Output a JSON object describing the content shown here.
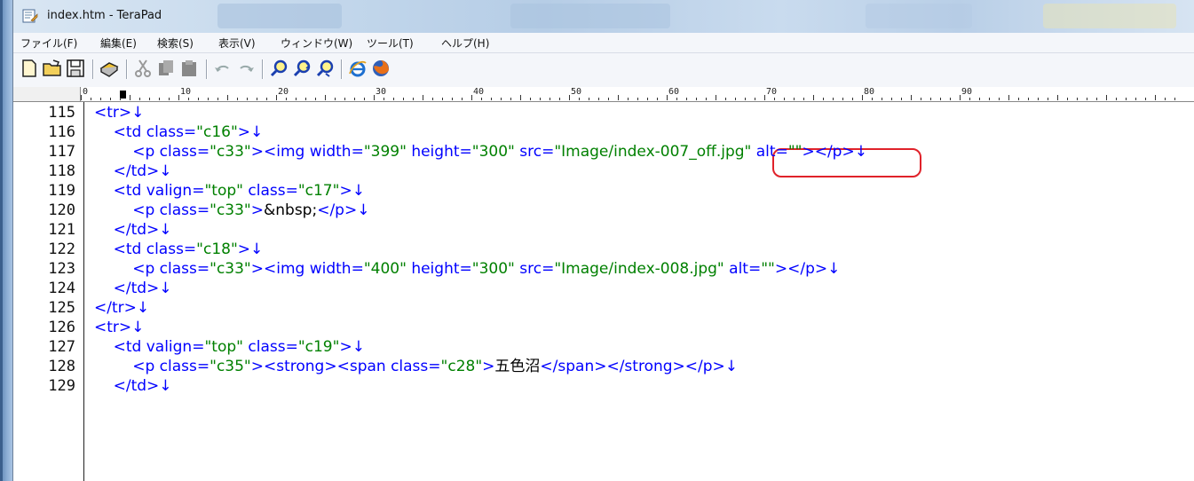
{
  "window": {
    "title": "index.htm - TeraPad"
  },
  "menu": [
    {
      "label": "ファイル(F)"
    },
    {
      "label": "編集(E)"
    },
    {
      "label": "検索(S)"
    },
    {
      "label": "表示(V)"
    },
    {
      "label": "ウィンドウ(W)"
    },
    {
      "label": "ツール(T)"
    },
    {
      "label": "ヘルプ(H)"
    }
  ],
  "toolbar": {
    "buttons": [
      {
        "icon": "new-file-icon"
      },
      {
        "icon": "open-folder-icon"
      },
      {
        "icon": "save-icon"
      },
      {
        "icon": "print-icon"
      },
      {
        "icon": "cut-icon"
      },
      {
        "icon": "copy-icon"
      },
      {
        "icon": "paste-icon"
      },
      {
        "icon": "undo-icon"
      },
      {
        "icon": "redo-icon"
      },
      {
        "icon": "search-icon"
      },
      {
        "icon": "search-next-icon"
      },
      {
        "icon": "search-prev-icon"
      },
      {
        "icon": "internet-explorer-icon"
      },
      {
        "icon": "firefox-icon"
      }
    ]
  },
  "ruler": {
    "labels": [
      "0",
      "10",
      "20",
      "30",
      "40",
      "50",
      "60",
      "70",
      "80",
      "90"
    ]
  },
  "editor": {
    "lines": [
      {
        "num": "115",
        "parts": [
          [
            "tag",
            "<tr>"
          ],
          [
            "nl",
            "↓"
          ]
        ]
      },
      {
        "num": "116",
        "parts": [
          [
            "tag",
            "    <td class="
          ],
          [
            "str",
            "\"c16\""
          ],
          [
            "tag",
            ">"
          ],
          [
            "nl",
            "↓"
          ]
        ]
      },
      {
        "num": "117",
        "parts": [
          [
            "tag",
            "        <p class="
          ],
          [
            "str",
            "\"c33\""
          ],
          [
            "tag",
            "><img width="
          ],
          [
            "str",
            "\"399\""
          ],
          [
            "tag",
            " height="
          ],
          [
            "str",
            "\"300\""
          ],
          [
            "tag",
            " src="
          ],
          [
            "str",
            "\"Image/index-007_off.jpg\""
          ],
          [
            "tag",
            " alt="
          ],
          [
            "str",
            "\"\""
          ],
          [
            "tag",
            "></p>"
          ],
          [
            "nl",
            "↓"
          ]
        ]
      },
      {
        "num": "118",
        "parts": [
          [
            "tag",
            "    </td>"
          ],
          [
            "nl",
            "↓"
          ]
        ]
      },
      {
        "num": "119",
        "parts": [
          [
            "tag",
            "    <td valign="
          ],
          [
            "str",
            "\"top\""
          ],
          [
            "tag",
            " class="
          ],
          [
            "str",
            "\"c17\""
          ],
          [
            "tag",
            ">"
          ],
          [
            "nl",
            "↓"
          ]
        ]
      },
      {
        "num": "120",
        "parts": [
          [
            "tag",
            "        <p class="
          ],
          [
            "str",
            "\"c33\""
          ],
          [
            "tag",
            ">"
          ],
          [
            "txt",
            "&nbsp;"
          ],
          [
            "tag",
            "</p>"
          ],
          [
            "nl",
            "↓"
          ]
        ]
      },
      {
        "num": "121",
        "parts": [
          [
            "tag",
            "    </td>"
          ],
          [
            "nl",
            "↓"
          ]
        ]
      },
      {
        "num": "122",
        "parts": [
          [
            "tag",
            "    <td class="
          ],
          [
            "str",
            "\"c18\""
          ],
          [
            "tag",
            ">"
          ],
          [
            "nl",
            "↓"
          ]
        ]
      },
      {
        "num": "123",
        "parts": [
          [
            "tag",
            "        <p class="
          ],
          [
            "str",
            "\"c33\""
          ],
          [
            "tag",
            "><img width="
          ],
          [
            "str",
            "\"400\""
          ],
          [
            "tag",
            " height="
          ],
          [
            "str",
            "\"300\""
          ],
          [
            "tag",
            " src="
          ],
          [
            "str",
            "\"Image/index-008.jpg\""
          ],
          [
            "tag",
            " alt="
          ],
          [
            "str",
            "\"\""
          ],
          [
            "tag",
            "></p>"
          ],
          [
            "nl",
            "↓"
          ]
        ]
      },
      {
        "num": "124",
        "parts": [
          [
            "tag",
            "    </td>"
          ],
          [
            "nl",
            "↓"
          ]
        ]
      },
      {
        "num": "125",
        "parts": [
          [
            "tag",
            "</tr>"
          ],
          [
            "nl",
            "↓"
          ]
        ]
      },
      {
        "num": "126",
        "parts": [
          [
            "tag",
            "<tr>"
          ],
          [
            "nl",
            "↓"
          ]
        ]
      },
      {
        "num": "127",
        "parts": [
          [
            "tag",
            "    <td valign="
          ],
          [
            "str",
            "\"top\""
          ],
          [
            "tag",
            " class="
          ],
          [
            "str",
            "\"c19\""
          ],
          [
            "tag",
            ">"
          ],
          [
            "nl",
            "↓"
          ]
        ]
      },
      {
        "num": "128",
        "parts": [
          [
            "tag",
            "        <p class="
          ],
          [
            "str",
            "\"c35\""
          ],
          [
            "tag",
            "><strong><span class="
          ],
          [
            "str",
            "\"c28\""
          ],
          [
            "tag",
            ">"
          ],
          [
            "txt",
            "五色沼"
          ],
          [
            "tag",
            "</span></strong></p>"
          ],
          [
            "nl",
            "↓"
          ]
        ]
      },
      {
        "num": "129",
        "parts": [
          [
            "tag",
            "    </td>"
          ],
          [
            "nl",
            "↓"
          ]
        ]
      }
    ]
  },
  "colors": {
    "tag": "#0000ff",
    "string": "#008000",
    "highlight": "#e0222a"
  }
}
